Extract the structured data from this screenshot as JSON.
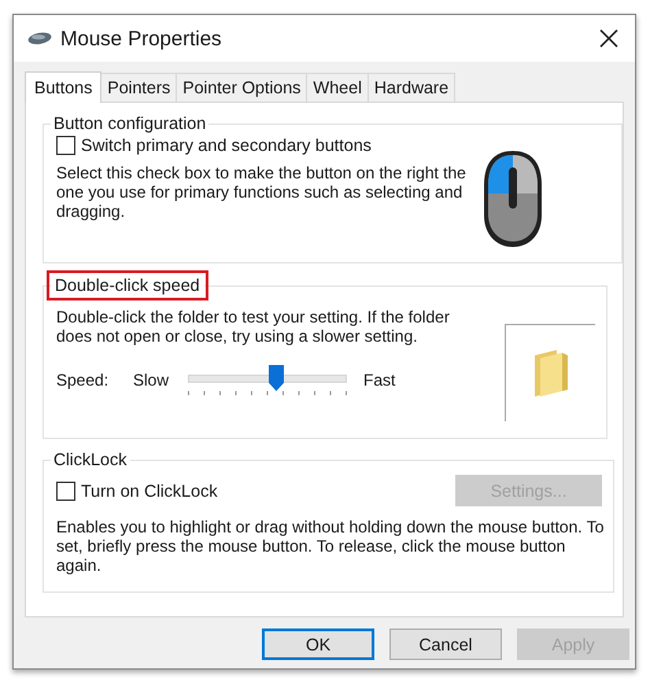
{
  "window": {
    "title": "Mouse Properties"
  },
  "tabs": [
    {
      "label": "Buttons",
      "selected": true
    },
    {
      "label": "Pointers",
      "selected": false
    },
    {
      "label": "Pointer Options",
      "selected": false
    },
    {
      "label": "Wheel",
      "selected": false
    },
    {
      "label": "Hardware",
      "selected": false
    }
  ],
  "button_configuration": {
    "title": "Button configuration",
    "highlighted": false,
    "checkbox": {
      "label": "Switch primary and secondary buttons",
      "checked": false
    },
    "description": "Select this check box to make the button on the right the one you use for primary functions such as selecting and dragging."
  },
  "double_click_speed": {
    "title": "Double-click speed",
    "highlighted": true,
    "description": "Double-click the folder to test your setting. If the folder does not open or close, try using a slower setting.",
    "speed_label": "Speed:",
    "slow_label": "Slow",
    "fast_label": "Fast",
    "slider": {
      "level": 0.58
    }
  },
  "clicklock": {
    "title": "ClickLock",
    "highlighted": false,
    "checkbox": {
      "label": "Turn on ClickLock",
      "checked": false
    },
    "settings_button": {
      "label": "Settings...",
      "disabled": true
    },
    "description": "Enables you to highlight or drag without holding down the mouse button. To set, briefly press the mouse button. To release, click the mouse button again."
  },
  "buttons": [
    {
      "label": "OK",
      "default": true,
      "disabled": false
    },
    {
      "label": "Cancel",
      "default": false,
      "disabled": false
    },
    {
      "label": "Apply",
      "default": false,
      "disabled": true
    }
  ]
}
